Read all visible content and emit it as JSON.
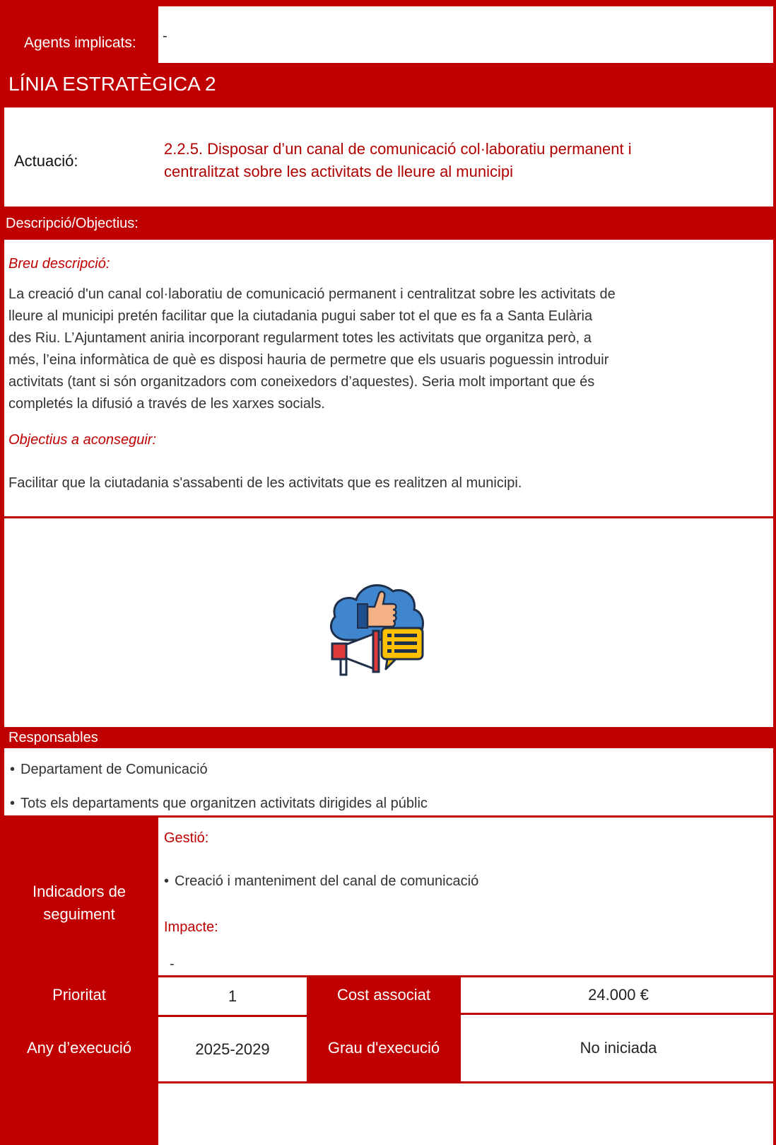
{
  "agents": {
    "label": "Agents implicats:",
    "value": "-"
  },
  "linia": {
    "title": "LÍNIA ESTRATÈGICA 2"
  },
  "actuacio": {
    "label": "Actuació:",
    "line1": "2.2.5. Disposar d’un canal de comunicació col·laboratiu permanent i",
    "line2": "centralitzat sobre les activitats de lleure al municipi"
  },
  "descripcio": {
    "header": "Descripció/Objectius:",
    "breu_label": "Breu descripció:",
    "breu_lines": [
      "La creació d'un canal col·laboratiu de comunicació permanent i centralitzat sobre les activitats de",
      "lleure al municipi pretén facilitar que la ciutadania pugui saber tot el que es fa a Santa Eulària",
      "des Riu. L’Ajuntament aniria incorporant regularment totes les activitats que organitza però, a",
      "més, l’eina informàtica de què es disposi hauria de permetre que els usuaris poguessin introduir",
      "activitats (tant si són organitzadors com coneixedors d’aquestes). Seria molt important que és",
      "completés la difusió a través de les xarxes socials."
    ],
    "objectius_label": "Objectius a aconseguir:",
    "objectius_text": "Facilitar que la ciutadania s'assabenti de les activitats que es realitzen al municipi."
  },
  "icon": {
    "name": "social-media-communication-icon"
  },
  "responsables": {
    "header": "Responsables",
    "items": [
      "Departament de Comunicació",
      "Tots els departaments que organitzen activitats dirigides al públic"
    ]
  },
  "indicadors": {
    "label_line1": "Indicadors de",
    "label_line2": "seguiment",
    "gestio_label": "Gestió:",
    "gestio_item": "Creació i manteniment del canal de comunicació",
    "impacte_label": "Impacte:",
    "impacte_value": "-"
  },
  "table": {
    "prioritat_label": "Prioritat",
    "prioritat_value": "1",
    "cost_label": "Cost associat",
    "cost_value": "24.000 €",
    "any_label": "Any d’execució",
    "any_value": "2025-2029",
    "grau_label": "Grau d'execució",
    "grau_value": "No iniciada"
  },
  "colors": {
    "accent": "#c00000"
  }
}
